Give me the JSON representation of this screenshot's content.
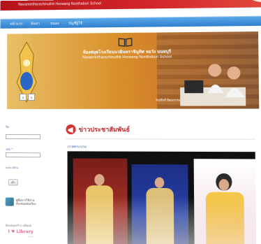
{
  "header": {
    "school_title": "Navamintharachinuthit Horwang Nonthaburi School"
  },
  "nav": {
    "items": [
      {
        "label": "หน้าแรก"
      },
      {
        "label": "ค้นหา"
      },
      {
        "label": "หนอง"
      },
      {
        "label": "บัญชีผู้ใช้"
      }
    ]
  },
  "banner": {
    "thai_name": "ห้องสมุดโรงเรียนนวมินทราชินูทิศ หอวัง นนทบุรี",
    "english_name": "Navamintharachinuthit Horwang Nonthaburi School",
    "motto": "รักษ์สิ่งดี มีคุณธรรม นำวิชาการ สืบสานความเป็นไทย",
    "prev_arrow": "‹",
    "next_arrow": "›"
  },
  "sidebar": {
    "login_label": "ชื่อ",
    "password_label": "รหัส *",
    "register_label": "ลงทะเบียน",
    "login_button": "เข้า",
    "manual_text_1": "คู่มือการใช้งาน",
    "manual_text_2": "ห้องสมุดอัจฉริยะ",
    "ebook_label": "ห้องสมุดสร้าง eBook",
    "library_logo": "I ♥ Library",
    "library_sub": "Online"
  },
  "news": {
    "title": "ข่าวประชาสัมพันธ์",
    "caption": "ภาพพระบรม"
  },
  "colors": {
    "top_bar": "#c81f25",
    "nav": "#3c8bd8",
    "news_title": "#c0262a",
    "caption_link": "#3b6fc9"
  }
}
